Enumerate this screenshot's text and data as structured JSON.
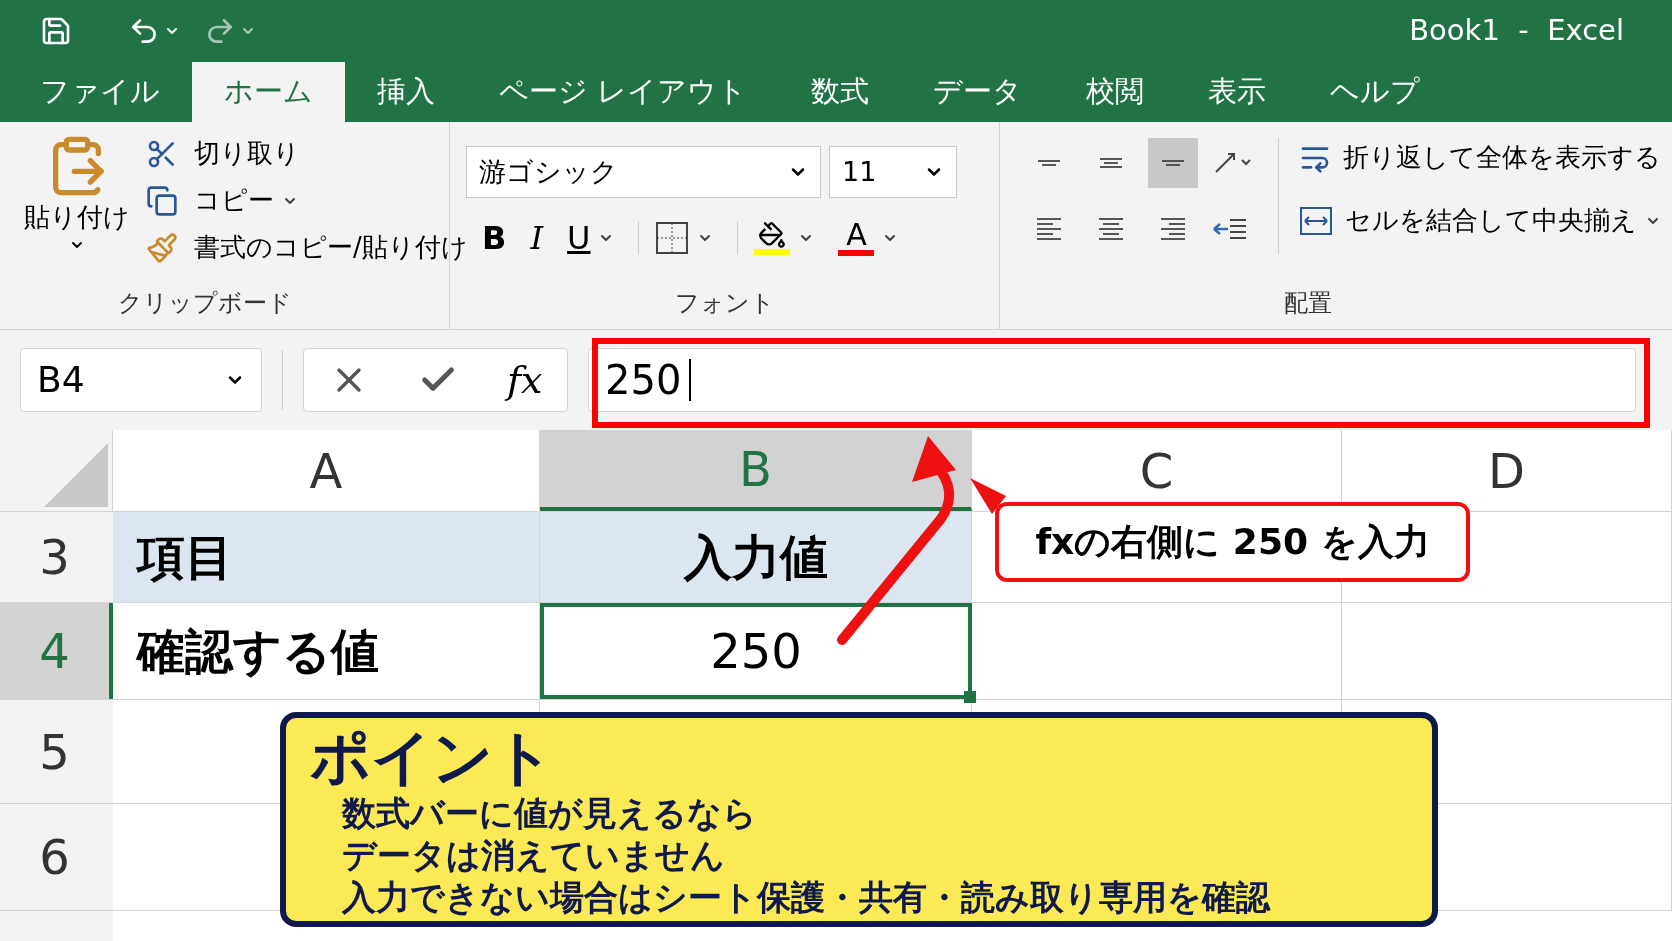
{
  "window": {
    "title": "Book1  -  Excel"
  },
  "tabs": [
    {
      "label": "ファイル",
      "selected": false
    },
    {
      "label": "ホーム",
      "selected": true
    },
    {
      "label": "挿入",
      "selected": false
    },
    {
      "label": "ページ レイアウト",
      "selected": false
    },
    {
      "label": "数式",
      "selected": false
    },
    {
      "label": "データ",
      "selected": false
    },
    {
      "label": "校閲",
      "selected": false
    },
    {
      "label": "表示",
      "selected": false
    },
    {
      "label": "ヘルプ",
      "selected": false
    }
  ],
  "ribbon": {
    "clipboard": {
      "label": "クリップボード",
      "paste": "貼り付け",
      "cut": "切り取り",
      "copy": "コピー",
      "format_painter": "書式のコピー/貼り付け"
    },
    "font": {
      "label": "フォント",
      "font_name": "游ゴシック",
      "font_size": "11",
      "bold": "B",
      "italic": "I",
      "underline": "U",
      "font_color": "A"
    },
    "alignment": {
      "label": "配置",
      "vertical": [
        {
          "kind": "top",
          "selected": false
        },
        {
          "kind": "middle",
          "selected": false
        },
        {
          "kind": "bottom",
          "selected": true
        }
      ],
      "horizontal": [
        {
          "kind": "left",
          "selected": false
        },
        {
          "kind": "center",
          "selected": false
        },
        {
          "kind": "right",
          "selected": false
        }
      ],
      "wrap_text": "折り返して全体を表示する",
      "merge_center": "セルを結合して中央揃え"
    }
  },
  "formula_bar": {
    "name_box": "B4",
    "fx": "fx",
    "value": "250"
  },
  "sheet": {
    "columns": [
      {
        "label": "A",
        "selected": false
      },
      {
        "label": "B",
        "selected": true
      },
      {
        "label": "C",
        "selected": false
      },
      {
        "label": "D",
        "selected": false
      }
    ],
    "rows": [
      {
        "number": "3",
        "selected": false,
        "cells": [
          "項目",
          "入力値"
        ]
      },
      {
        "number": "4",
        "selected": true,
        "cells": [
          "確認する値",
          "250"
        ]
      },
      {
        "number": "5",
        "selected": false,
        "cells": []
      },
      {
        "number": "6",
        "selected": false,
        "cells": []
      }
    ]
  },
  "annotations": {
    "callout": "fxの右側に 250 を入力",
    "point": {
      "title": "ポイント",
      "lines": [
        "数式バーに値が見えるなら",
        "データは消えていません",
        "入力できない場合はシート保護・共有・読み取り専用を確認"
      ]
    }
  }
}
